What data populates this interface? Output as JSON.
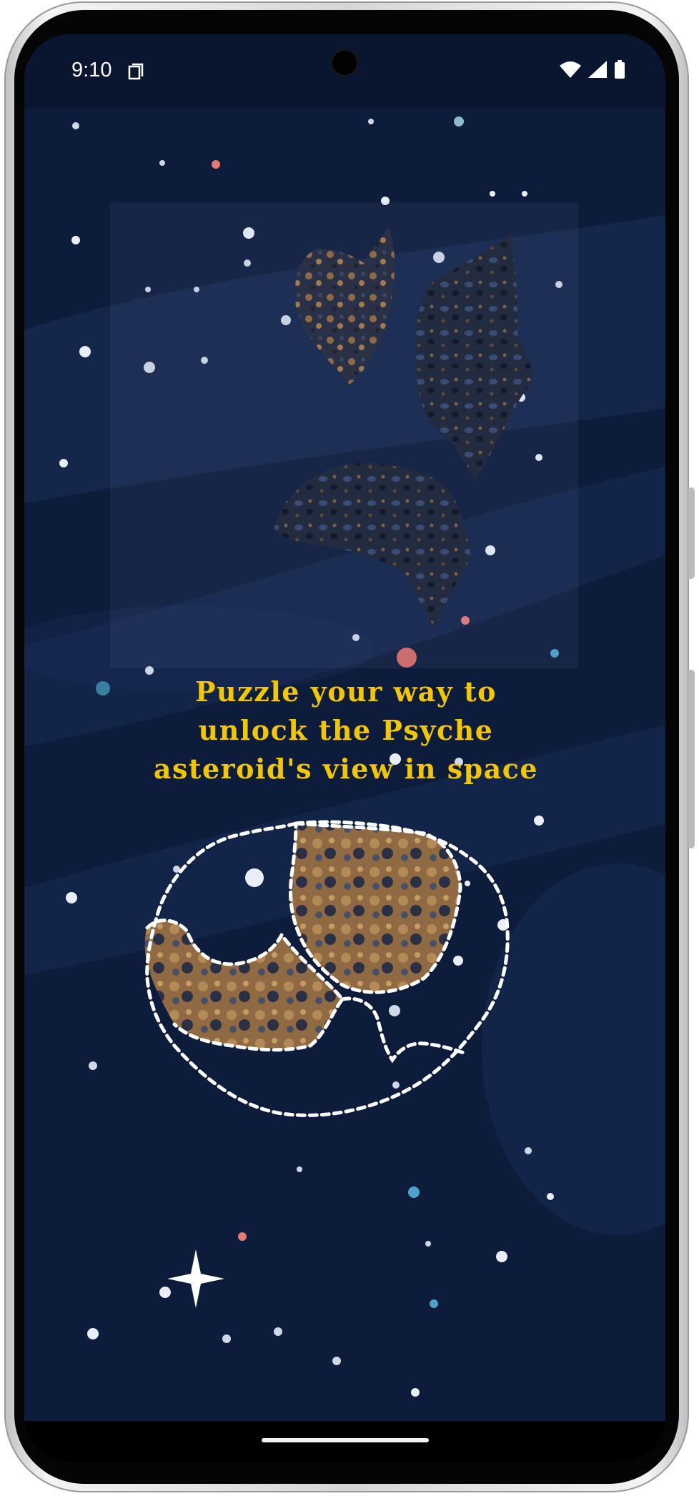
{
  "status_bar": {
    "time": "9:10",
    "icons": [
      "sim-card-icon",
      "wifi-icon",
      "cellular-signal-icon",
      "battery-icon"
    ]
  },
  "headline": {
    "lines": [
      "Puzzle your way to",
      "unlock the Psyche",
      "asteroid's view in space"
    ]
  },
  "puzzle": {
    "pieces_remaining": 3,
    "pieces_placed": 2,
    "target": "psyche-asteroid-outline"
  },
  "colors": {
    "background": "#0e1c3b",
    "headline": "#f2c700",
    "outline": "#ffffff",
    "asteroid_rock": "#8a6a47",
    "asteroid_dark": "#1d2336"
  }
}
